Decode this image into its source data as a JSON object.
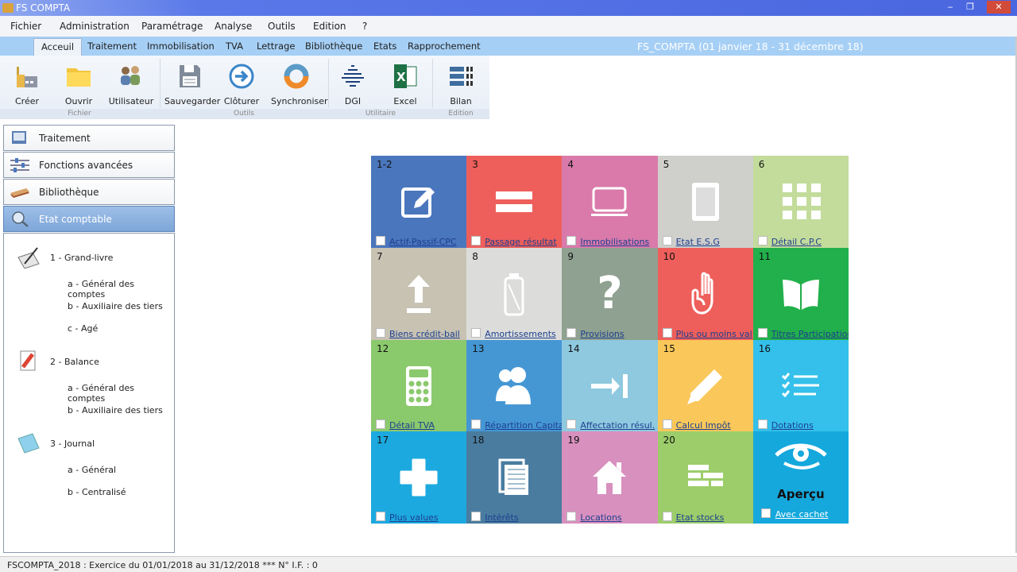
{
  "window": {
    "title": "FS COMPTA",
    "minimize": "‒",
    "restore": "❐",
    "close": "✕"
  },
  "menu": [
    "Fichier",
    "Administration",
    "Paramétrage",
    "Analyse",
    "Outils",
    "Edition",
    "?"
  ],
  "tabs": [
    "Acceuil",
    "Traitement",
    "Immobilisation",
    "TVA",
    "Lettrage",
    "Bibliothèque",
    "Etats",
    "Rapprochement"
  ],
  "fiscal_period": "FS_COMPTA  (01 janvier 18 - 31 décembre 18)",
  "ribbon": {
    "buttons": [
      "Créer",
      "Ouvrir",
      "Utilisateur",
      "Sauvegarder",
      "Clôturer",
      "Synchroniser",
      "DGI",
      "Excel",
      "Bilan"
    ],
    "groups": [
      "Fichier",
      "Outils",
      "Utilitaire",
      "Edition"
    ]
  },
  "nav": [
    "Traitement",
    "Fonctions avancées",
    "Bibliothèque",
    "Etat comptable"
  ],
  "tree": {
    "grand_livre": "1 - Grand-livre",
    "gl_a": "a - Général des comptes",
    "gl_b": "b - Auxiliaire des tiers",
    "gl_c": "c - Agé",
    "balance": "2 - Balance",
    "bal_a": "a - Général des comptes",
    "bal_b": "b - Auxiliaire des tiers",
    "journal": "3 - Journal",
    "j_a": "a - Général",
    "j_b": "b - Centralisé"
  },
  "tiles": [
    {
      "num": "1-2",
      "label": "Actif-Passif-CPC",
      "color": "#4a76bd",
      "icon": "edit-icon"
    },
    {
      "num": "3",
      "label": "Passage résultat",
      "color": "#ee5f5b",
      "icon": "equals-icon"
    },
    {
      "num": "4",
      "label": "Immobilisations",
      "color": "#d97aab",
      "icon": "laptop-icon"
    },
    {
      "num": "5",
      "label": "Etat E.S.G",
      "color": "#cfcfcb",
      "icon": "document-icon"
    },
    {
      "num": "6",
      "label": "Détail C.P.C",
      "color": "#c3dc9b",
      "icon": "grid-icon"
    },
    {
      "num": "7",
      "label": "Biens crédit-bail",
      "color": "#c7c2b2",
      "icon": "upload-icon"
    },
    {
      "num": "8",
      "label": "Amortissements",
      "color": "#dcdddb",
      "icon": "battery-icon"
    },
    {
      "num": "9",
      "label": "Provisions",
      "color": "#8fa190",
      "icon": "question-icon"
    },
    {
      "num": "10",
      "label": "Plus ou moins val",
      "color": "#ee5f5b",
      "icon": "hand-icon"
    },
    {
      "num": "11",
      "label": "Titres Participation",
      "color": "#21b04b",
      "icon": "book-icon"
    },
    {
      "num": "12",
      "label": "Détail TVA",
      "color": "#8bc96d",
      "icon": "calculator-icon"
    },
    {
      "num": "13",
      "label": "Répartition Capital",
      "color": "#4597d4",
      "icon": "users-icon"
    },
    {
      "num": "14",
      "label": "Affectation résul.",
      "color": "#8ec9df",
      "icon": "arrow-to-bar-icon"
    },
    {
      "num": "15",
      "label": "Calcul Impôt",
      "color": "#fac85a",
      "icon": "pencil-icon"
    },
    {
      "num": "16",
      "label": "Dotations",
      "color": "#34c0ea",
      "icon": "checklist-icon"
    },
    {
      "num": "17",
      "label": "Plus values",
      "color": "#1ca9df",
      "icon": "plus-icon"
    },
    {
      "num": "18",
      "label": "Intérêts",
      "color": "#4a7ca0",
      "icon": "files-icon"
    },
    {
      "num": "19",
      "label": "Locations",
      "color": "#d890be",
      "icon": "house-icon"
    },
    {
      "num": "20",
      "label": "Etat stocks",
      "color": "#9ccd6a",
      "icon": "bricks-icon"
    }
  ],
  "preview": {
    "title": "Aperçu",
    "label": "Avec cachet",
    "color": "#15a8dc",
    "icon": "eye-icon"
  },
  "status": "FSCOMPTA_2018 : Exercice du 01/01/2018 au 31/12/2018  ***  N° I.F. : 0"
}
